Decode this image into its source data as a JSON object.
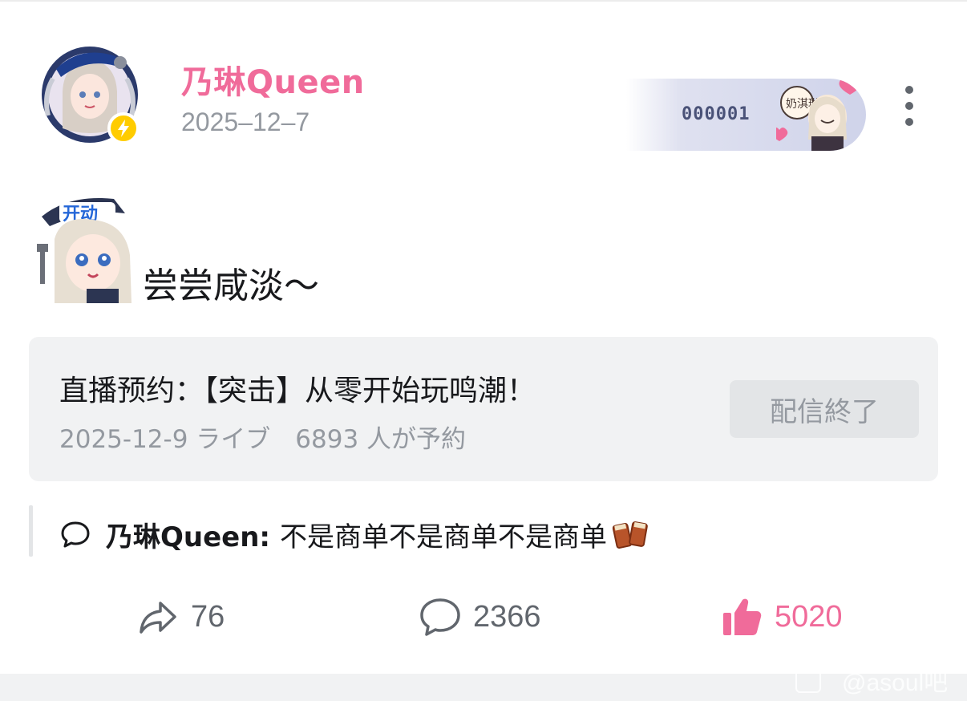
{
  "post": {
    "author": "乃琳Queen",
    "date": "2025–12–7",
    "fan_card_number": "000001",
    "text": "尝尝咸淡～",
    "sticker_text": "开动"
  },
  "reservation": {
    "title": "直播预约：【突击】从零开始玩鸣潮！",
    "meta": "2025-12-9 ライブ　6893 人が予約",
    "button_label": "配信終了"
  },
  "comment_preview": {
    "user": "乃琳Queen:",
    "text": "不是商单不是商单不是商单"
  },
  "actions": {
    "share_count": "76",
    "comment_count": "2366",
    "like_count": "5020"
  },
  "watermark": "@asoul吧",
  "colors": {
    "accent_pink": "#f06b9a",
    "muted_gray": "#9499a0",
    "card_bg": "#f1f2f3",
    "badge_yellow": "#ffcc00"
  },
  "icons": [
    "more-vertical-icon",
    "lightning-icon",
    "comment-bubble-icon",
    "share-icon",
    "reply-icon",
    "thumbs-up-icon",
    "cheers-drink-icon"
  ]
}
